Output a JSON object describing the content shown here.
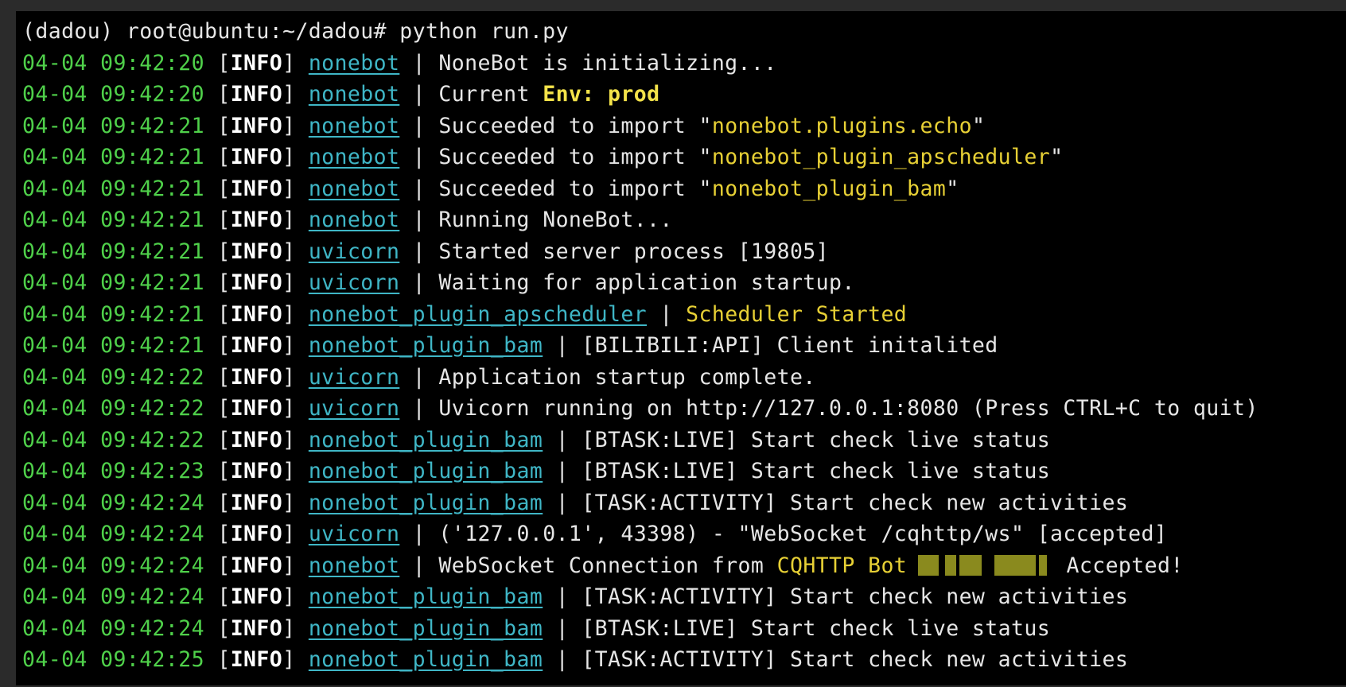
{
  "prompt": "(dadou) root@ubuntu:~/dadou# python run.py",
  "colors": {
    "timestamp": "#4fd04a",
    "module": "#3fb6c6",
    "highlight": "#e7d035",
    "background": "#000000"
  },
  "log_lines": [
    {
      "ts": "04-04 09:42:20",
      "level": "INFO",
      "module": "nonebot",
      "pre": "NoneBot is initializing...",
      "hl": "",
      "post": ""
    },
    {
      "ts": "04-04 09:42:20",
      "level": "INFO",
      "module": "nonebot",
      "pre": "Current ",
      "hl": "Env: prod",
      "post": ""
    },
    {
      "ts": "04-04 09:42:21",
      "level": "INFO",
      "module": "nonebot",
      "pre": "Succeeded to import \"",
      "hl": "nonebot.plugins.echo",
      "post": "\""
    },
    {
      "ts": "04-04 09:42:21",
      "level": "INFO",
      "module": "nonebot",
      "pre": "Succeeded to import \"",
      "hl": "nonebot_plugin_apscheduler",
      "post": "\""
    },
    {
      "ts": "04-04 09:42:21",
      "level": "INFO",
      "module": "nonebot",
      "pre": "Succeeded to import \"",
      "hl": "nonebot_plugin_bam",
      "post": "\""
    },
    {
      "ts": "04-04 09:42:21",
      "level": "INFO",
      "module": "nonebot",
      "pre": "Running NoneBot...",
      "hl": "",
      "post": ""
    },
    {
      "ts": "04-04 09:42:21",
      "level": "INFO",
      "module": "uvicorn",
      "pre": "Started server process [19805]",
      "hl": "",
      "post": ""
    },
    {
      "ts": "04-04 09:42:21",
      "level": "INFO",
      "module": "uvicorn",
      "pre": "Waiting for application startup.",
      "hl": "",
      "post": ""
    },
    {
      "ts": "04-04 09:42:21",
      "level": "INFO",
      "module": "nonebot_plugin_apscheduler",
      "pre": "",
      "hl": "Scheduler Started",
      "post": ""
    },
    {
      "ts": "04-04 09:42:21",
      "level": "INFO",
      "module": "nonebot_plugin_bam",
      "pre": "[BILIBILI:API] Client initalited",
      "hl": "",
      "post": ""
    },
    {
      "ts": "04-04 09:42:22",
      "level": "INFO",
      "module": "uvicorn",
      "pre": "Application startup complete.",
      "hl": "",
      "post": ""
    },
    {
      "ts": "04-04 09:42:22",
      "level": "INFO",
      "module": "uvicorn",
      "pre": "Uvicorn running on http://127.0.0.1:8080 (Press CTRL+C to quit)",
      "hl": "",
      "post": ""
    },
    {
      "ts": "04-04 09:42:22",
      "level": "INFO",
      "module": "nonebot_plugin_bam",
      "pre": "[BTASK:LIVE] Start check live status",
      "hl": "",
      "post": ""
    },
    {
      "ts": "04-04 09:42:23",
      "level": "INFO",
      "module": "nonebot_plugin_bam",
      "pre": "[BTASK:LIVE] Start check live status",
      "hl": "",
      "post": ""
    },
    {
      "ts": "04-04 09:42:24",
      "level": "INFO",
      "module": "nonebot_plugin_bam",
      "pre": "[TASK:ACTIVITY] Start check new activities",
      "hl": "",
      "post": ""
    },
    {
      "ts": "04-04 09:42:24",
      "level": "INFO",
      "module": "uvicorn",
      "pre": "('127.0.0.1', 43398) - \"WebSocket /cqhttp/ws\" [accepted]",
      "hl": "",
      "post": ""
    },
    {
      "ts": "04-04 09:42:24",
      "level": "INFO",
      "module": "nonebot",
      "pre": "WebSocket Connection from ",
      "hl": "CQHTTP Bot",
      "post": " Accepted!",
      "redacted": true
    },
    {
      "ts": "04-04 09:42:24",
      "level": "INFO",
      "module": "nonebot_plugin_bam",
      "pre": "[TASK:ACTIVITY] Start check new activities",
      "hl": "",
      "post": ""
    },
    {
      "ts": "04-04 09:42:24",
      "level": "INFO",
      "module": "nonebot_plugin_bam",
      "pre": "[BTASK:LIVE] Start check live status",
      "hl": "",
      "post": ""
    },
    {
      "ts": "04-04 09:42:25",
      "level": "INFO",
      "module": "nonebot_plugin_bam",
      "pre": "[TASK:ACTIVITY] Start check new activities",
      "hl": "",
      "post": ""
    }
  ]
}
